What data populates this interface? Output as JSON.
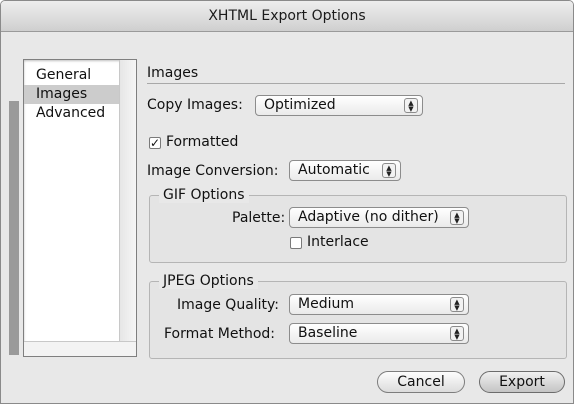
{
  "window": {
    "title": "XHTML Export Options"
  },
  "sidebar": {
    "items": [
      {
        "label": "General",
        "selected": false
      },
      {
        "label": "Images",
        "selected": true
      },
      {
        "label": "Advanced",
        "selected": false
      }
    ]
  },
  "images_section": {
    "title": "Images",
    "copy_images": {
      "label": "Copy Images:",
      "value": "Optimized"
    },
    "formatted": {
      "label": "Formatted",
      "checked": true,
      "mark": "✓"
    },
    "image_conversion": {
      "label": "Image Conversion:",
      "value": "Automatic"
    }
  },
  "gif_options": {
    "title": "GIF Options",
    "palette": {
      "label": "Palette:",
      "value": "Adaptive (no dither)"
    },
    "interlace": {
      "label": "Interlace",
      "checked": false
    }
  },
  "jpeg_options": {
    "title": "JPEG Options",
    "image_quality": {
      "label": "Image Quality:",
      "value": "Medium"
    },
    "format_method": {
      "label": "Format Method:",
      "value": "Baseline"
    }
  },
  "buttons": {
    "cancel": "Cancel",
    "export": "Export"
  },
  "icons": {
    "popup_arrows": "▲▼"
  }
}
